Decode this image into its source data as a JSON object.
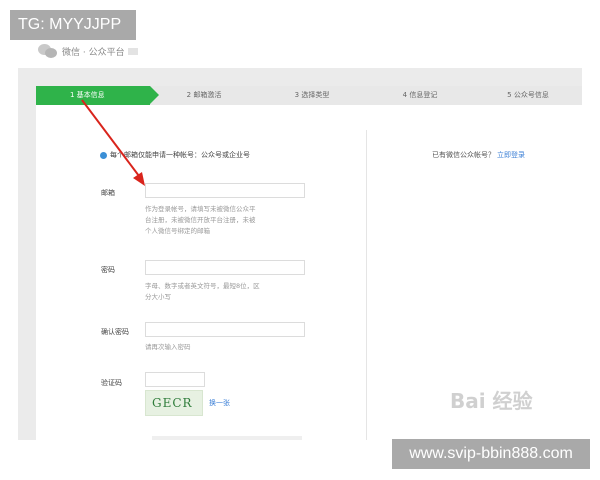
{
  "overlay": {
    "tg": "TG: MYYJJPP",
    "url": "www.svip-bbin888.com",
    "watermark": "Bai 经验"
  },
  "brand": {
    "title": "微信 · 公众平台"
  },
  "steps": [
    {
      "label": "1 基本信息"
    },
    {
      "label": "2 邮箱激活"
    },
    {
      "label": "3 选择类型"
    },
    {
      "label": "4 信息登记"
    },
    {
      "label": "5 公众号信息"
    }
  ],
  "form": {
    "notice": "每个邮箱仅能申请一种帐号：公众号或企业号",
    "email": {
      "label": "邮箱",
      "hint": [
        "作为登录帐号，请填写未被微信公众平",
        "台注册，未被微信开放平台注册，未被",
        "个人微信号绑定的邮箱"
      ]
    },
    "password": {
      "label": "密码",
      "hint": [
        "字母、数字或者英文符号，最短8位，区",
        "分大小写"
      ]
    },
    "confirm": {
      "label": "确认密码",
      "hint": "请再次输入密码"
    },
    "captcha": {
      "label": "验证码",
      "image_text": "GECR",
      "change": "换一张"
    }
  },
  "right": {
    "question": "已有微信公众帐号？",
    "login_link": "立即登录"
  },
  "colors": {
    "accent": "#2fb34a",
    "link": "#3b7fd6",
    "arrow": "#d9241c"
  }
}
